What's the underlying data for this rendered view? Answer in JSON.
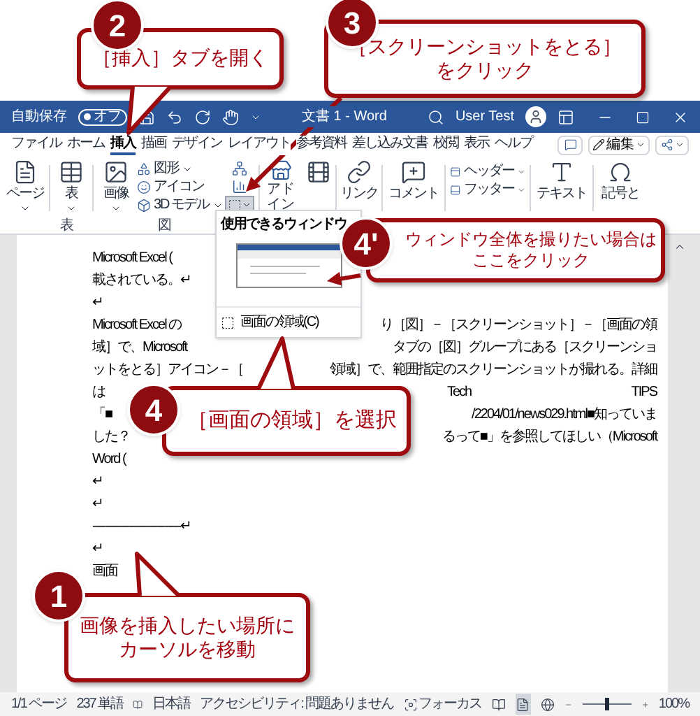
{
  "callouts": [
    {
      "number": "2",
      "kind": "pointer",
      "lines": [
        "［挿入］タブを開く"
      ]
    },
    {
      "number": "3",
      "kind": "arrow",
      "lines": [
        "［スクリーンショットをとる］",
        "をクリック"
      ]
    },
    {
      "number": "4'",
      "kind": "arrow",
      "lines": [
        "ウィンドウ全体を撮りたい場合は",
        "ここをクリック"
      ]
    },
    {
      "number": "4",
      "kind": "pointer",
      "lines": [
        "［画面の領域］を選択"
      ]
    },
    {
      "number": "1",
      "kind": "pointer",
      "lines": [
        "画像を挿入したい場所に",
        "カーソルを移動"
      ]
    }
  ],
  "title_bar": {
    "autosave": "自動保存",
    "autosave_state": "オフ",
    "title": "文書 1 - Word",
    "user": "User Test"
  },
  "tabs": [
    {
      "label": "ファイル",
      "selected": false
    },
    {
      "label": "ホーム",
      "selected": false
    },
    {
      "label": "挿入",
      "selected": true
    },
    {
      "label": "描画",
      "selected": false
    },
    {
      "label": "デザイン",
      "selected": false
    },
    {
      "label": "レイアウト",
      "selected": false
    },
    {
      "label": "参考資料",
      "selected": false
    },
    {
      "label": "差し込み文書",
      "selected": false
    },
    {
      "label": "校閲",
      "selected": false
    },
    {
      "label": "表示",
      "selected": false
    },
    {
      "label": "ヘルプ",
      "selected": false
    }
  ],
  "edit_button": "編集",
  "ribbon": {
    "page": "ページ",
    "table": "表",
    "pictures": "画像",
    "shapes": "図形",
    "icons": "アイコン",
    "models_3d": "3D モデル",
    "addins": "アドイン",
    "link": "リンク",
    "comment": "コメント",
    "header": "ヘッダー",
    "footer": "フッター",
    "text": "テキスト",
    "symbols": "記号と",
    "group_labels": [
      "表",
      "図"
    ]
  },
  "screenshot_menu": {
    "expanded": true,
    "heading": "使用できるウィンドウ",
    "item": "画面の領域(C)"
  },
  "document": {
    "lines": [
      [
        "Microsoft Excel ("
      ],
      [
        "載されている。↵"
      ],
      [
        "↵"
      ],
      [
        "Microsoft Excel の",
        "り［図］－［スクリーンショット］－［画面の領"
      ],
      [
        "域］で、Microsoft",
        "タブの［図］グループにある［スクリーンショ"
      ],
      [
        "ットをとる］アイコン－［",
        "領域］で、範囲指定のスクリーンショットが撮れる。詳細"
      ],
      [
        "は",
        "Tech",
        "TIPS"
      ],
      [
        "「■",
        "/2204/01/news029.html■知っていま"
      ],
      [
        "した？",
        "るって■」を参照してほしい（Microsoft"
      ],
      [
        "Word ("
      ],
      [
        "↵"
      ],
      [
        "↵"
      ],
      [
        "---------------------------↵"
      ],
      [
        "↵"
      ],
      [
        "画面"
      ]
    ]
  },
  "status_bar": {
    "page": "1/1 ページ",
    "words": "237 単語",
    "language": "日本語",
    "accessibility": "アクセシビリティ: 問題ありません",
    "focus": "フォーカス",
    "views": [
      {
        "selected": false
      },
      {
        "selected": true
      },
      {
        "selected": false
      }
    ],
    "zoom": {
      "level": 0.5
    },
    "zoom_percent": "100%"
  }
}
